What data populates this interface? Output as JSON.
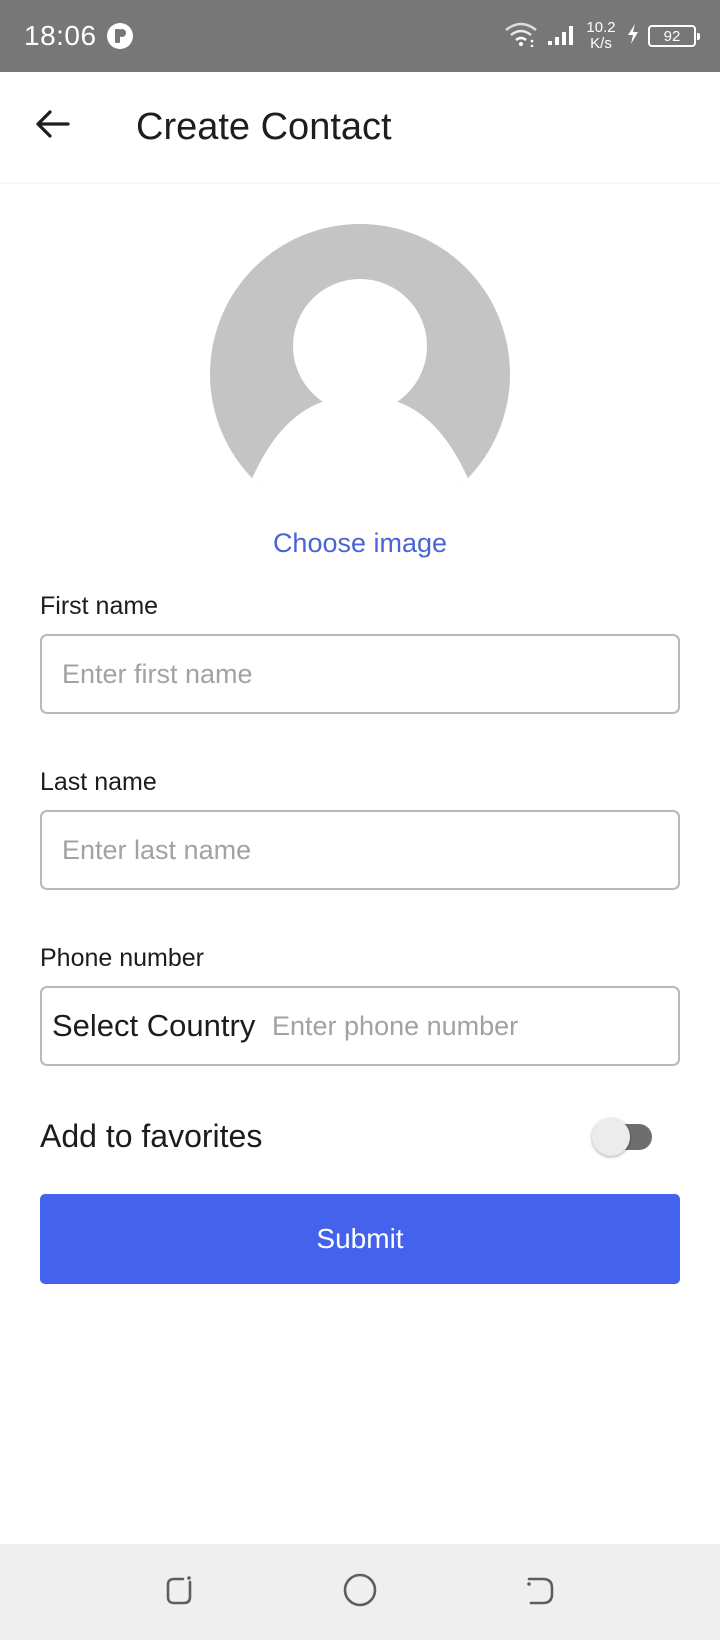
{
  "status_bar": {
    "time": "18:06",
    "net_speed_value": "10.2",
    "net_speed_unit": "K/s",
    "battery": "92",
    "icons": [
      "app-notification-icon",
      "wifi-icon",
      "signal-icon",
      "charging-icon",
      "battery-icon"
    ]
  },
  "header": {
    "title": "Create Contact",
    "back_icon": "arrow-left-icon"
  },
  "avatar": {
    "icon": "default-avatar-icon",
    "choose_label": "Choose image",
    "color": "#c4c4c4"
  },
  "form": {
    "first_name": {
      "label": "First name",
      "placeholder": "Enter first name",
      "value": ""
    },
    "last_name": {
      "label": "Last name",
      "placeholder": "Enter last name",
      "value": ""
    },
    "phone": {
      "label": "Phone number",
      "country_label": "Select Country",
      "placeholder": "Enter phone number",
      "value": ""
    },
    "favorites": {
      "label": "Add to favorites",
      "on": false
    },
    "submit_label": "Submit"
  },
  "colors": {
    "accent": "#4462ec",
    "link": "#4a64d6",
    "status_bar": "#777777"
  },
  "nav_bar": {
    "icons": [
      "recent-apps-icon",
      "home-icon",
      "back-icon"
    ]
  }
}
